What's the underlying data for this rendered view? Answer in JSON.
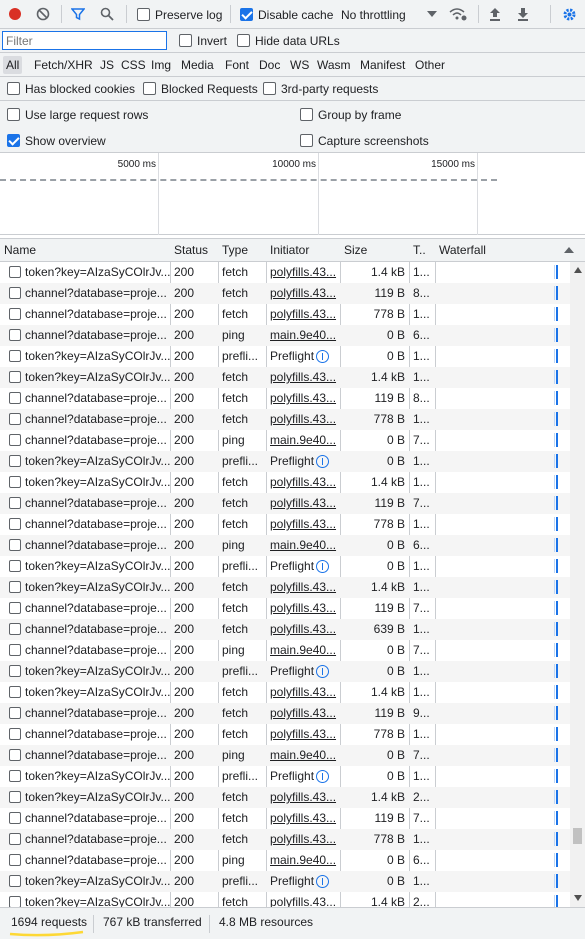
{
  "toolbar": {
    "preserve_log": "Preserve log",
    "disable_cache": "Disable cache",
    "throttling": "No throttling"
  },
  "filterbar": {
    "placeholder": "Filter",
    "invert": "Invert",
    "hide_data_urls": "Hide data URLs"
  },
  "types": [
    "All",
    "Fetch/XHR",
    "JS",
    "CSS",
    "Img",
    "Media",
    "Font",
    "Doc",
    "WS",
    "Wasm",
    "Manifest",
    "Other"
  ],
  "options": {
    "has_blocked_cookies": "Has blocked cookies",
    "blocked_requests": "Blocked Requests",
    "third_party": "3rd-party requests",
    "large_rows": "Use large request rows",
    "group_by_frame": "Group by frame",
    "show_overview": "Show overview",
    "capture_screenshots": "Capture screenshots"
  },
  "overview": {
    "ticks": [
      "5000 ms",
      "10000 ms",
      "15000 ms"
    ]
  },
  "columns": {
    "name": "Name",
    "status": "Status",
    "type": "Type",
    "initiator": "Initiator",
    "size": "Size",
    "time": "T..",
    "waterfall": "Waterfall"
  },
  "rows": [
    {
      "name": "token?key=AIzaSyCOlrJv...",
      "status": "200",
      "type": "fetch",
      "initiator": "polyfills.43...",
      "size": "1.4 kB",
      "time": "1..."
    },
    {
      "name": "channel?database=proje...",
      "status": "200",
      "type": "fetch",
      "initiator": "polyfills.43...",
      "size": "119 B",
      "time": "8..."
    },
    {
      "name": "channel?database=proje...",
      "status": "200",
      "type": "fetch",
      "initiator": "polyfills.43...",
      "size": "778 B",
      "time": "1..."
    },
    {
      "name": "channel?database=proje...",
      "status": "200",
      "type": "ping",
      "initiator": "main.9e40...",
      "size": "0 B",
      "time": "6..."
    },
    {
      "name": "token?key=AIzaSyCOlrJv...",
      "status": "200",
      "type": "prefli...",
      "initiator": "Preflight",
      "size": "0 B",
      "time": "1..."
    },
    {
      "name": "token?key=AIzaSyCOlrJv...",
      "status": "200",
      "type": "fetch",
      "initiator": "polyfills.43...",
      "size": "1.4 kB",
      "time": "1..."
    },
    {
      "name": "channel?database=proje...",
      "status": "200",
      "type": "fetch",
      "initiator": "polyfills.43...",
      "size": "119 B",
      "time": "8..."
    },
    {
      "name": "channel?database=proje...",
      "status": "200",
      "type": "fetch",
      "initiator": "polyfills.43...",
      "size": "778 B",
      "time": "1..."
    },
    {
      "name": "channel?database=proje...",
      "status": "200",
      "type": "ping",
      "initiator": "main.9e40...",
      "size": "0 B",
      "time": "7..."
    },
    {
      "name": "token?key=AIzaSyCOlrJv...",
      "status": "200",
      "type": "prefli...",
      "initiator": "Preflight",
      "size": "0 B",
      "time": "1..."
    },
    {
      "name": "token?key=AIzaSyCOlrJv...",
      "status": "200",
      "type": "fetch",
      "initiator": "polyfills.43...",
      "size": "1.4 kB",
      "time": "1..."
    },
    {
      "name": "channel?database=proje...",
      "status": "200",
      "type": "fetch",
      "initiator": "polyfills.43...",
      "size": "119 B",
      "time": "7..."
    },
    {
      "name": "channel?database=proje...",
      "status": "200",
      "type": "fetch",
      "initiator": "polyfills.43...",
      "size": "778 B",
      "time": "1..."
    },
    {
      "name": "channel?database=proje...",
      "status": "200",
      "type": "ping",
      "initiator": "main.9e40...",
      "size": "0 B",
      "time": "6..."
    },
    {
      "name": "token?key=AIzaSyCOlrJv...",
      "status": "200",
      "type": "prefli...",
      "initiator": "Preflight",
      "size": "0 B",
      "time": "1..."
    },
    {
      "name": "token?key=AIzaSyCOlrJv...",
      "status": "200",
      "type": "fetch",
      "initiator": "polyfills.43...",
      "size": "1.4 kB",
      "time": "1..."
    },
    {
      "name": "channel?database=proje...",
      "status": "200",
      "type": "fetch",
      "initiator": "polyfills.43...",
      "size": "119 B",
      "time": "7..."
    },
    {
      "name": "channel?database=proje...",
      "status": "200",
      "type": "fetch",
      "initiator": "polyfills.43...",
      "size": "639 B",
      "time": "1..."
    },
    {
      "name": "channel?database=proje...",
      "status": "200",
      "type": "ping",
      "initiator": "main.9e40...",
      "size": "0 B",
      "time": "7..."
    },
    {
      "name": "token?key=AIzaSyCOlrJv...",
      "status": "200",
      "type": "prefli...",
      "initiator": "Preflight",
      "size": "0 B",
      "time": "1..."
    },
    {
      "name": "token?key=AIzaSyCOlrJv...",
      "status": "200",
      "type": "fetch",
      "initiator": "polyfills.43...",
      "size": "1.4 kB",
      "time": "1..."
    },
    {
      "name": "channel?database=proje...",
      "status": "200",
      "type": "fetch",
      "initiator": "polyfills.43...",
      "size": "119 B",
      "time": "9..."
    },
    {
      "name": "channel?database=proje...",
      "status": "200",
      "type": "fetch",
      "initiator": "polyfills.43...",
      "size": "778 B",
      "time": "1..."
    },
    {
      "name": "channel?database=proje...",
      "status": "200",
      "type": "ping",
      "initiator": "main.9e40...",
      "size": "0 B",
      "time": "7..."
    },
    {
      "name": "token?key=AIzaSyCOlrJv...",
      "status": "200",
      "type": "prefli...",
      "initiator": "Preflight",
      "size": "0 B",
      "time": "1..."
    },
    {
      "name": "token?key=AIzaSyCOlrJv...",
      "status": "200",
      "type": "fetch",
      "initiator": "polyfills.43...",
      "size": "1.4 kB",
      "time": "2..."
    },
    {
      "name": "channel?database=proje...",
      "status": "200",
      "type": "fetch",
      "initiator": "polyfills.43...",
      "size": "119 B",
      "time": "7..."
    },
    {
      "name": "channel?database=proje...",
      "status": "200",
      "type": "fetch",
      "initiator": "polyfills.43...",
      "size": "778 B",
      "time": "1..."
    },
    {
      "name": "channel?database=proje...",
      "status": "200",
      "type": "ping",
      "initiator": "main.9e40...",
      "size": "0 B",
      "time": "6..."
    },
    {
      "name": "token?key=AIzaSyCOlrJv...",
      "status": "200",
      "type": "prefli...",
      "initiator": "Preflight",
      "size": "0 B",
      "time": "1..."
    },
    {
      "name": "token?key=AIzaSyCOlrJv...",
      "status": "200",
      "type": "fetch",
      "initiator": "polyfills.43...",
      "size": "1.4 kB",
      "time": "2..."
    }
  ],
  "statusbar": {
    "requests": "1694 requests",
    "transferred": "767 kB transferred",
    "resources": "4.8 MB resources"
  },
  "colors": {
    "record": "#d93025",
    "accent": "#1a73e8",
    "highlight": "#fdd835"
  }
}
